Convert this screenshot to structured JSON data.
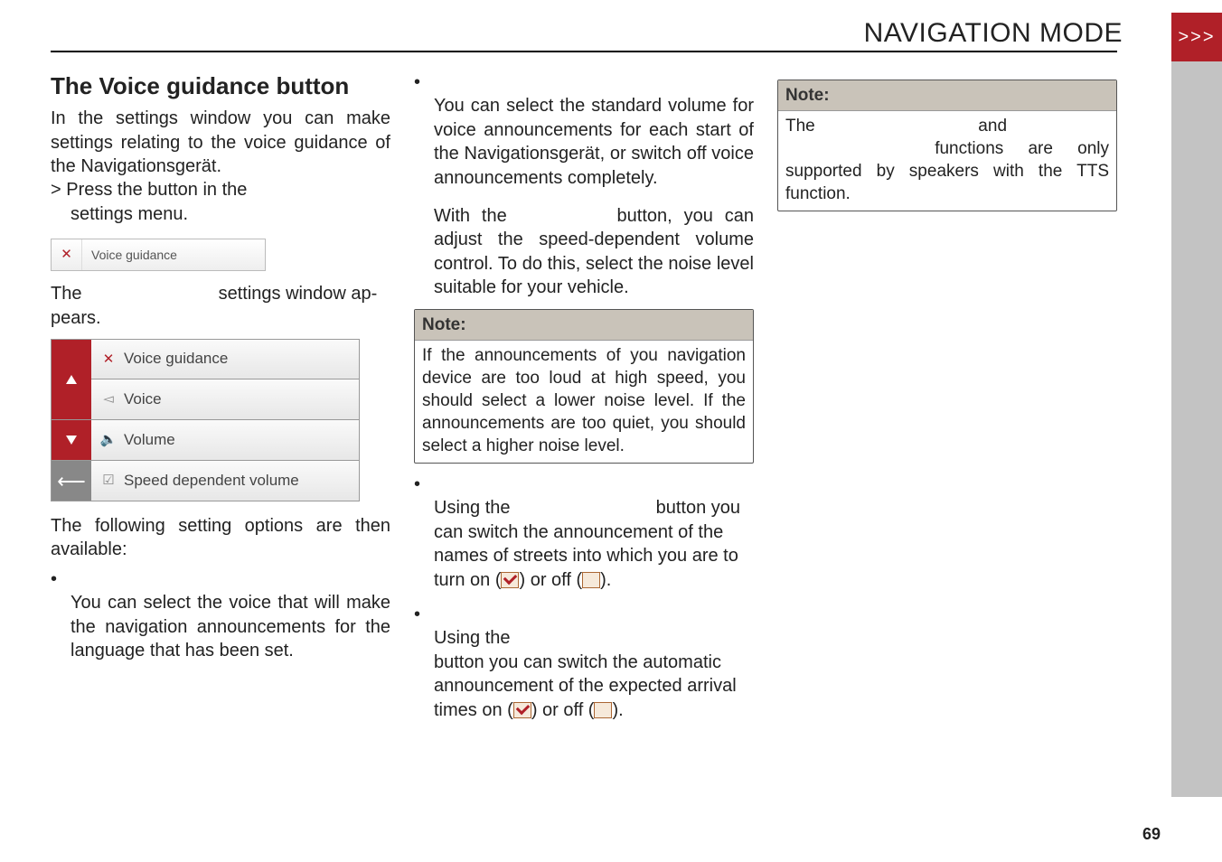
{
  "header": {
    "title": "NAVIGATION MODE",
    "tab_chevrons": ">>>"
  },
  "col1": {
    "heading": "The Voice guidance button",
    "p1a": "In the ",
    "p1b": " settings window you can make settings relating to the voice guidance of the Navigationsgerät.",
    "press_a": "> Press the ",
    "press_b": " button in the",
    "press_c": "settings menu.",
    "bar_label": "Voice guidance",
    "p2a": "The ",
    "p2b": " settings window ap-",
    "p2c": "pears.",
    "menu": {
      "m1": "Voice guidance",
      "m2": "Voice",
      "m3": "Volume",
      "m4": "Speed dependent volume"
    },
    "p3": "The following setting options are then available:",
    "voice_text": "You can select the voice that will make the navigation announcements for the language that has been set."
  },
  "col2": {
    "vol1": "You can select the standard volume for voice announcements for each start of the Navigationsgerät, or switch off voice announcements completely.",
    "vol2a": "With the ",
    "vol2b": " button, you can adjust the speed-dependent volume control. To do this, select the noise level suitable for your vehicle.",
    "note_head": "Note:",
    "note_body": "If the announcements of you navigation device are too loud at high speed, you should select a lower noise level. If the announcements are too quiet, you should select a higher noise level.",
    "streets_a": "Using the ",
    "streets_b": " button you can switch the announcement of the names of streets into which you are to turn on (",
    "streets_c": ") or off (",
    "streets_d": ").",
    "arr_a": "Using the ",
    "arr_b": "button you can switch the automatic announcement of the expected arrival times on (",
    "arr_c": ") or off (",
    "arr_d": ")."
  },
  "col3": {
    "note_head": "Note:",
    "note_a": "The ",
    "note_b": " and ",
    "note_c": " functions are only supported by speakers with the TTS function."
  },
  "page_number": "69"
}
